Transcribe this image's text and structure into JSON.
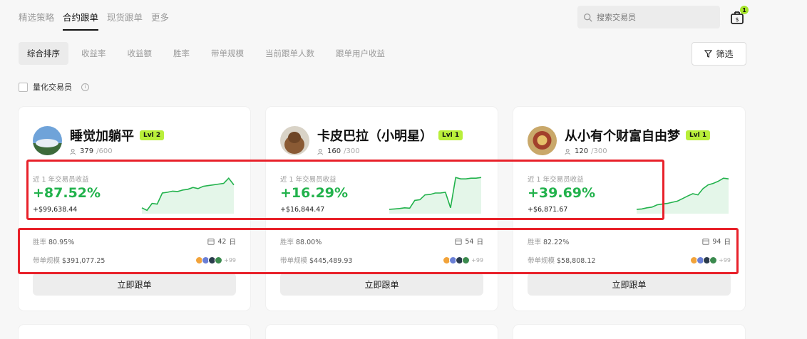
{
  "nav": {
    "tabs": [
      {
        "label": "精选策略"
      },
      {
        "label": "合约跟单"
      },
      {
        "label": "现货跟单"
      },
      {
        "label": "更多"
      }
    ]
  },
  "search": {
    "placeholder": "搜索交易员"
  },
  "gift_badge": "1",
  "filters": {
    "chips": [
      {
        "label": "综合排序"
      },
      {
        "label": "收益率"
      },
      {
        "label": "收益额"
      },
      {
        "label": "胜率"
      },
      {
        "label": "带单规模"
      },
      {
        "label": "当前跟单人数"
      },
      {
        "label": "跟单用户收益"
      }
    ],
    "filter_button": "筛选"
  },
  "quant_label": "量化交易员",
  "labels": {
    "roi_label": "近 1 年交易员收益",
    "winrate": "胜率",
    "aum": "带单规模",
    "days_unit": "日",
    "follow": "立即跟单"
  },
  "colors": {
    "positive": "#22b24c",
    "highlight_box": "#e8212a",
    "lvl_badge": "#b9ef3a"
  },
  "cards": [
    {
      "name": "睡觉加躺平",
      "level": "Lvl 2",
      "followers": "379",
      "followers_max": "/600",
      "roi": "+87.52%",
      "pnl": "+$99,638.44",
      "winrate": "80.95%",
      "days": "42",
      "aum": "$391,077.25",
      "coins_more": "+99",
      "sparkline": [
        0.1,
        0.03,
        0.22,
        0.2,
        0.5,
        0.52,
        0.55,
        0.54,
        0.58,
        0.6,
        0.65,
        0.62,
        0.68,
        0.7,
        0.72,
        0.74,
        0.76,
        0.9,
        0.72
      ]
    },
    {
      "name": "卡皮巴拉（小明星）",
      "level": "Lvl 1",
      "followers": "160",
      "followers_max": "/300",
      "roi": "+16.29%",
      "pnl": "+$16,844.47",
      "winrate": "88.00%",
      "days": "54",
      "aum": "$445,489.93",
      "coins_more": "+99",
      "sparkline": [
        0.06,
        0.07,
        0.08,
        0.1,
        0.09,
        0.3,
        0.32,
        0.45,
        0.46,
        0.5,
        0.5,
        0.52,
        0.1,
        0.92,
        0.88,
        0.88,
        0.9,
        0.9,
        0.92
      ]
    },
    {
      "name": "从小有个财富自由梦",
      "level": "Lvl 1",
      "followers": "120",
      "followers_max": "/300",
      "roi": "+39.69%",
      "pnl": "+$6,871.67",
      "winrate": "82.22%",
      "days": "94",
      "aum": "$58,808.12",
      "coins_more": "+99",
      "sparkline": [
        0.06,
        0.07,
        0.1,
        0.12,
        0.18,
        0.2,
        0.22,
        0.25,
        0.28,
        0.35,
        0.42,
        0.48,
        0.45,
        0.62,
        0.72,
        0.76,
        0.82,
        0.9,
        0.88
      ]
    }
  ]
}
